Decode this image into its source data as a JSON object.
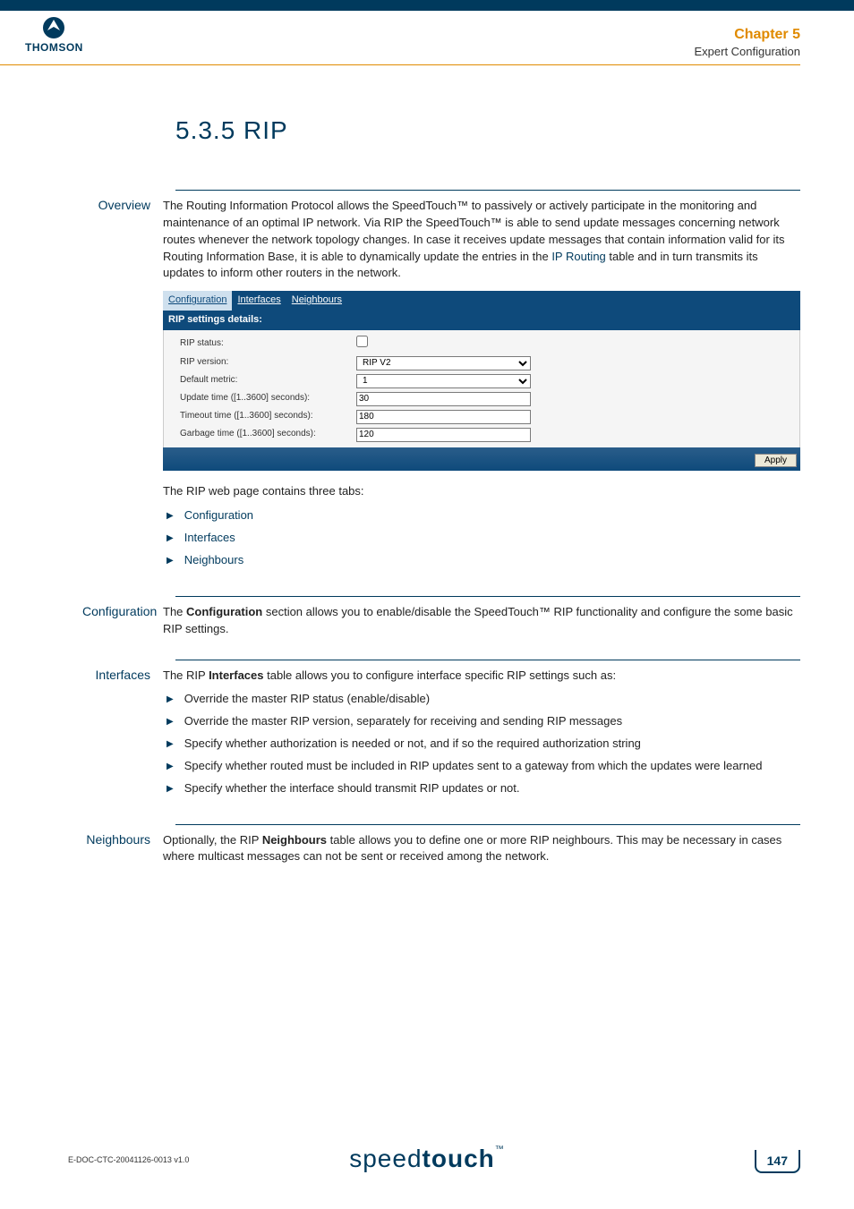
{
  "header": {
    "logo_text": "THOMSON",
    "chapter": "Chapter 5",
    "chapter_sub": "Expert Configuration"
  },
  "title": "5.3.5   RIP",
  "overview": {
    "label": "Overview",
    "text_before_link": "The Routing Information Protocol allows the SpeedTouch™ to passively or actively participate in the monitoring and maintenance of an optimal IP network. Via RIP the SpeedTouch™ is able to send update messages concerning network routes whenever the network topology changes. In case it receives update messages that contain information valid for its Routing Information Base, it is able to dynamically update the entries in the ",
    "link_text": "IP Routing",
    "text_after_link": " table and in turn transmits its updates to inform other routers in the network.",
    "tabs_intro": "The RIP web page contains three tabs:",
    "tab_items": [
      "Configuration",
      "Interfaces",
      "Neighbours"
    ]
  },
  "panel": {
    "tabs": [
      "Configuration",
      "Interfaces",
      "Neighbours"
    ],
    "header": "RIP settings details:",
    "rows": [
      {
        "label": "RIP status:",
        "type": "checkbox",
        "value": ""
      },
      {
        "label": "RIP version:",
        "type": "select",
        "value": "RIP V2"
      },
      {
        "label": "Default metric:",
        "type": "select",
        "value": "1"
      },
      {
        "label": "Update time ([1..3600] seconds):",
        "type": "text",
        "value": "30"
      },
      {
        "label": "Timeout time ([1..3600] seconds):",
        "type": "text",
        "value": "180"
      },
      {
        "label": "Garbage time ([1..3600] seconds):",
        "type": "text",
        "value": "120"
      }
    ],
    "apply": "Apply"
  },
  "configuration": {
    "label": "Configuration",
    "text_prefix": "The ",
    "text_bold": "Configuration",
    "text_suffix": " section allows you to enable/disable the SpeedTouch™ RIP functionality and configure the some basic RIP settings."
  },
  "interfaces": {
    "label": "Interfaces",
    "text_prefix": "The RIP ",
    "text_bold": "Interfaces",
    "text_suffix": " table allows you to configure interface specific RIP settings such as:",
    "items": [
      "Override the master RIP status (enable/disable)",
      "Override the master RIP version, separately for receiving and sending RIP messages",
      "Specify whether authorization is needed or not, and if so the required authorization string",
      "Specify whether routed must be included in RIP updates sent to a gateway from which the updates were learned",
      "Specify whether the interface should transmit RIP updates or not."
    ]
  },
  "neighbours": {
    "label": "Neighbours",
    "text_prefix": "Optionally, the RIP ",
    "text_bold": "Neighbours",
    "text_suffix": " table allows you to define one or more RIP neighbours. This may be necessary in cases where multicast messages can not be sent or received among the network."
  },
  "footer": {
    "doc_id": "E-DOC-CTC-20041126-0013 v1.0",
    "brand_light": "speed",
    "brand_bold": "touch",
    "tm": "™",
    "page": "147"
  }
}
